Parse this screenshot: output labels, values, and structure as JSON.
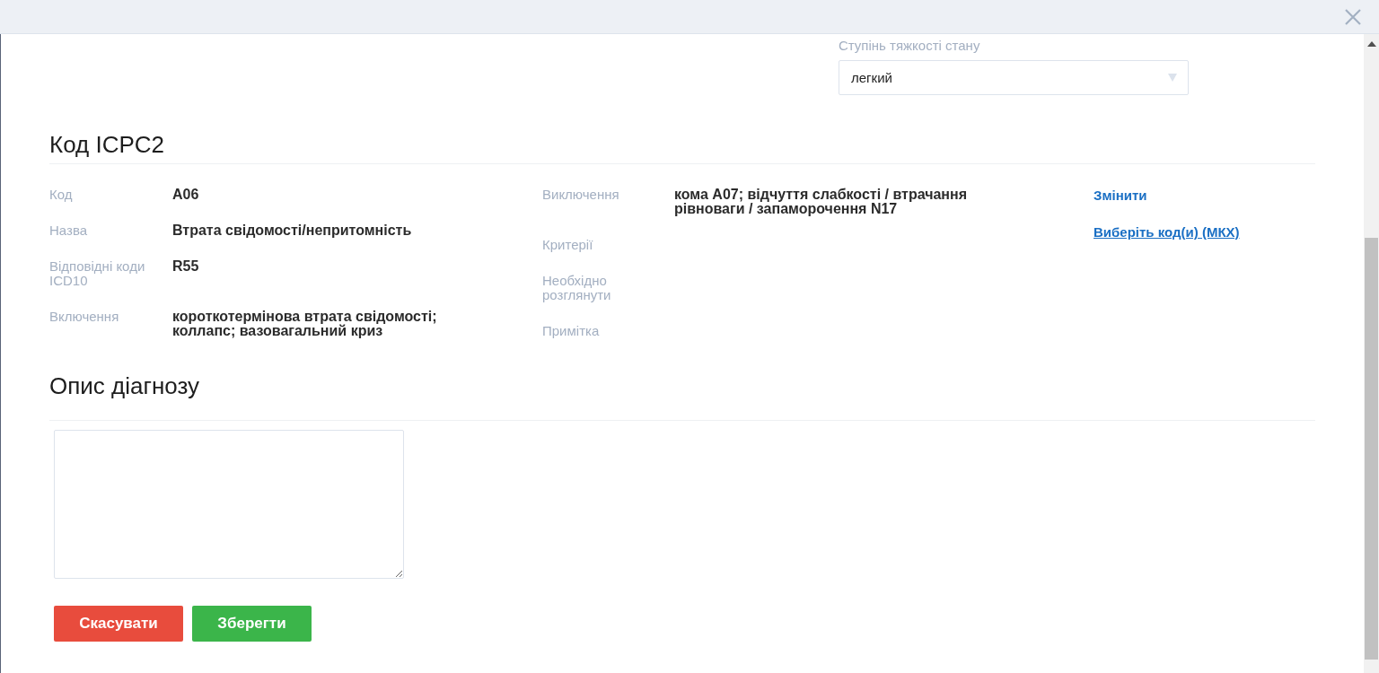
{
  "severity": {
    "label": "Ступінь тяжкості стану",
    "value": "легкий"
  },
  "icpc": {
    "title": "Код ICPC2",
    "fields_left": [
      {
        "label": "Код",
        "value": "A06"
      },
      {
        "label": "Назва",
        "value": "Втрата свідомості/непритомність"
      },
      {
        "label": "Відповідні коди ICD10",
        "value": "R55"
      },
      {
        "label": "Включення",
        "value": "короткотермінова втрата свідомості; коллапс; вазовагальний криз"
      }
    ],
    "fields_right": [
      {
        "label": "Виключення",
        "value": "кома A07; відчуття слабкості / втрачання рівноваги / запаморочення N17"
      },
      {
        "label": "Критерії"
      },
      {
        "label": "Необхідно розглянути"
      },
      {
        "label": "Примітка"
      }
    ],
    "links": [
      {
        "label": "Змінити",
        "kind": "action"
      },
      {
        "label": "Виберіть код(и) (МКХ)",
        "kind": "link"
      }
    ]
  },
  "description": {
    "title": "Опис діагнозу"
  },
  "buttons": [
    {
      "label": "Скасувати",
      "kind": "cancel"
    },
    {
      "label": "Зберегти",
      "kind": "save"
    }
  ]
}
